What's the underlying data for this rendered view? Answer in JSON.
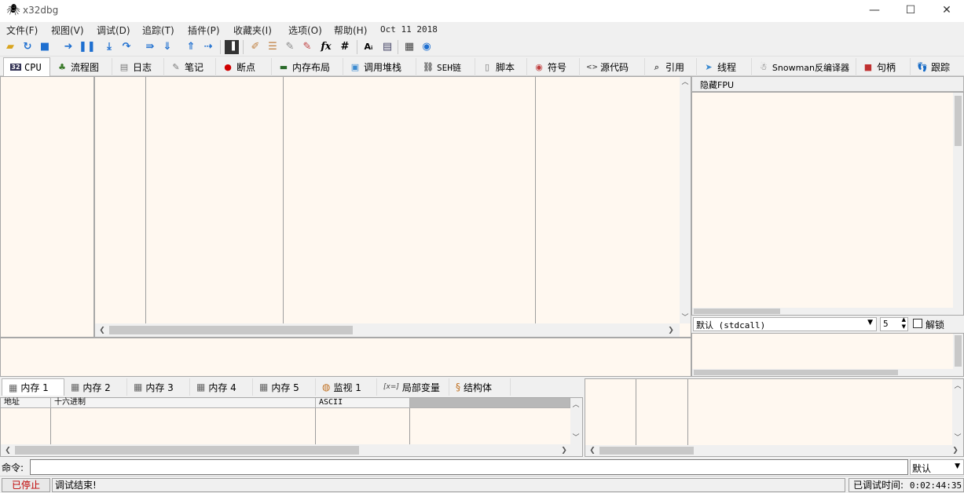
{
  "window": {
    "title": "x32dbg",
    "minimize": "—",
    "maximize": "☐",
    "close": "✕"
  },
  "menu": [
    "文件(F)",
    "视图(V)",
    "调试(D)",
    "追踪(T)",
    "插件(P)",
    "收藏夹(I)",
    "选项(O)",
    "帮助(H)",
    "Oct 11 2018"
  ],
  "tabs": [
    {
      "label": "CPU",
      "icon": "cpu-icon",
      "glyph": "32"
    },
    {
      "label": "流程图",
      "icon": "tree-icon",
      "glyph": "♣"
    },
    {
      "label": "日志",
      "icon": "log-icon",
      "glyph": "▤"
    },
    {
      "label": "笔记",
      "icon": "notes-icon",
      "glyph": "✎"
    },
    {
      "label": "断点",
      "icon": "breakpoint-icon",
      "glyph": "●"
    },
    {
      "label": "内存布局",
      "icon": "memory-map-icon",
      "glyph": "▬"
    },
    {
      "label": "调用堆栈",
      "icon": "callstack-icon",
      "glyph": "▣"
    },
    {
      "label": "SEH链",
      "icon": "seh-icon",
      "glyph": "⛓"
    },
    {
      "label": "脚本",
      "icon": "script-icon",
      "glyph": "▯"
    },
    {
      "label": "符号",
      "icon": "symbol-icon",
      "glyph": "◉"
    },
    {
      "label": "源代码",
      "icon": "source-icon",
      "glyph": "<>"
    },
    {
      "label": "引用",
      "icon": "reference-icon",
      "glyph": "⌕"
    },
    {
      "label": "线程",
      "icon": "thread-icon",
      "glyph": "➤"
    },
    {
      "label": "Snowman反编译器",
      "icon": "snowman-icon",
      "glyph": "☃"
    },
    {
      "label": "句柄",
      "icon": "handle-icon",
      "glyph": "■"
    },
    {
      "label": "跟踪",
      "icon": "trace-icon",
      "glyph": "👣"
    }
  ],
  "fpu_panel": {
    "hide_fpu": "隐藏FPU"
  },
  "callconv": {
    "selected": "默认 (stdcall)",
    "arg_count": "5",
    "unlock_label": "解锁"
  },
  "dump_tabs": [
    {
      "label": "内存 1",
      "icon": "memory-icon",
      "glyph": "▦"
    },
    {
      "label": "内存 2",
      "icon": "memory-icon",
      "glyph": "▦"
    },
    {
      "label": "内存 3",
      "icon": "memory-icon",
      "glyph": "▦"
    },
    {
      "label": "内存 4",
      "icon": "memory-icon",
      "glyph": "▦"
    },
    {
      "label": "内存 5",
      "icon": "memory-icon",
      "glyph": "▦"
    },
    {
      "label": "监视 1",
      "icon": "watch-icon",
      "glyph": "◍"
    },
    {
      "label": "局部变量",
      "icon": "locals-icon",
      "glyph": "[x=]"
    },
    {
      "label": "结构体",
      "icon": "struct-icon",
      "glyph": "§"
    }
  ],
  "dump_headers": [
    "地址",
    "十六进制",
    "ASCII"
  ],
  "command": {
    "label": "命令:",
    "value": "",
    "mode": "默认"
  },
  "status": {
    "state": "已停止",
    "message": "调试结束!",
    "time_label": "已调试时间:",
    "time_value": "0:02:44:35"
  },
  "colors": {
    "pane_bg": "#fff8f0",
    "stopped": "#c00000"
  }
}
